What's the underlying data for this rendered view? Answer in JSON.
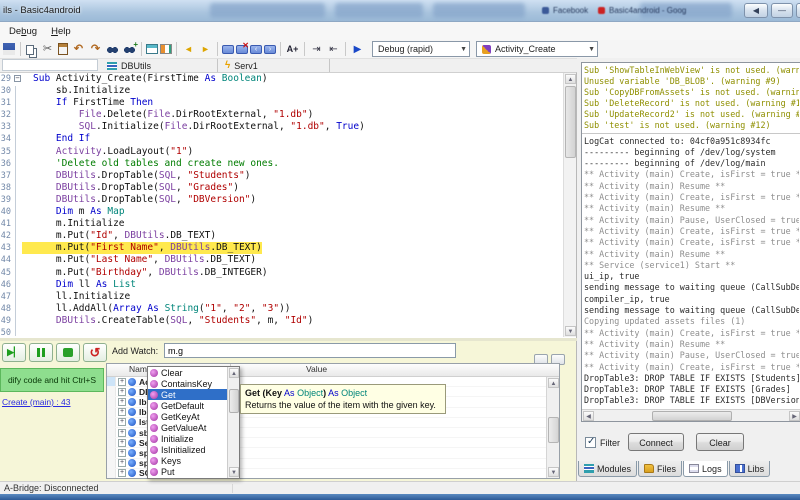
{
  "window": {
    "title": "ils - Basic4android"
  },
  "background": {
    "browser_tabs": [
      "Facebook",
      "Basic4android - Goog"
    ]
  },
  "menu": {
    "items": [
      {
        "label": "Debug",
        "underline": 2
      },
      {
        "label": "Help",
        "underline": 0
      }
    ]
  },
  "toolbar": {
    "icons": [
      "save",
      "sep",
      "copy",
      "cut",
      "paste",
      "undo",
      "redo",
      "find",
      "find-next",
      "sep",
      "designer",
      "bridge",
      "sep",
      "nav-back",
      "nav-forward",
      "sep",
      "comment-add",
      "comment-remove",
      "comment-prev",
      "comment-next",
      "sep",
      "font-size",
      "sep",
      "indent",
      "outdent",
      "sep",
      "run"
    ],
    "debug_mode": "Debug (rapid)",
    "current_sub": "Activity_Create"
  },
  "module_tabs": [
    "DBUtils",
    "Serv1"
  ],
  "editor": {
    "lines": [
      {
        "n": 29,
        "fold": 1,
        "t": [
          [
            "k",
            "Sub "
          ],
          [
            "p",
            "Activity_Create(FirstTime "
          ],
          [
            "k",
            "As "
          ],
          [
            "t",
            "Boolean"
          ],
          [
            "p",
            ")"
          ]
        ]
      },
      {
        "n": 30,
        "t": [
          [
            "p",
            "    sb.Initialize"
          ]
        ]
      },
      {
        "n": 31,
        "t": [
          [
            "p",
            "    "
          ],
          [
            "k",
            "If "
          ],
          [
            "p",
            "FirstTime "
          ],
          [
            "k",
            "Then"
          ]
        ]
      },
      {
        "n": 32,
        "t": [
          [
            "p",
            "        "
          ],
          [
            "m",
            "File"
          ],
          [
            "p",
            ".Delete("
          ],
          [
            "m",
            "File"
          ],
          [
            "p",
            ".DirRootExternal, "
          ],
          [
            "s",
            "\"1.db\""
          ],
          [
            "p",
            ")"
          ]
        ]
      },
      {
        "n": 33,
        "t": [
          [
            "p",
            "        "
          ],
          [
            "m",
            "SQL"
          ],
          [
            "p",
            ".Initialize("
          ],
          [
            "m",
            "File"
          ],
          [
            "p",
            ".DirRootExternal, "
          ],
          [
            "s",
            "\"1.db\""
          ],
          [
            "p",
            ", "
          ],
          [
            "k",
            "True"
          ],
          [
            "p",
            ")"
          ]
        ]
      },
      {
        "n": 34,
        "t": [
          [
            "p",
            "    "
          ],
          [
            "k",
            "End If"
          ]
        ]
      },
      {
        "n": 35,
        "t": [
          [
            "p",
            "    "
          ],
          [
            "m",
            "Activity"
          ],
          [
            "p",
            ".LoadLayout("
          ],
          [
            "s",
            "\"1\""
          ],
          [
            "p",
            ")"
          ]
        ]
      },
      {
        "n": 36,
        "t": [
          [
            "p",
            "    "
          ],
          [
            "c",
            "'Delete old tables and create new ones."
          ]
        ]
      },
      {
        "n": 37,
        "t": [
          [
            "p",
            "    "
          ],
          [
            "m",
            "DBUtils"
          ],
          [
            "p",
            ".DropTable("
          ],
          [
            "m",
            "SQL"
          ],
          [
            "p",
            ", "
          ],
          [
            "s",
            "\"Students\""
          ],
          [
            "p",
            ")"
          ]
        ]
      },
      {
        "n": 38,
        "t": [
          [
            "p",
            "    "
          ],
          [
            "m",
            "DBUtils"
          ],
          [
            "p",
            ".DropTable("
          ],
          [
            "m",
            "SQL"
          ],
          [
            "p",
            ", "
          ],
          [
            "s",
            "\"Grades\""
          ],
          [
            "p",
            ")"
          ]
        ]
      },
      {
        "n": 39,
        "t": [
          [
            "p",
            "    "
          ],
          [
            "m",
            "DBUtils"
          ],
          [
            "p",
            ".DropTable("
          ],
          [
            "m",
            "SQL"
          ],
          [
            "p",
            ", "
          ],
          [
            "s",
            "\"DBVersion\""
          ],
          [
            "p",
            ")"
          ]
        ]
      },
      {
        "n": 40,
        "t": [
          [
            "p",
            "    "
          ],
          [
            "k",
            "Dim "
          ],
          [
            "p",
            "m "
          ],
          [
            "k",
            "As "
          ],
          [
            "t",
            "Map"
          ]
        ]
      },
      {
        "n": 41,
        "t": [
          [
            "p",
            "    m.Initialize"
          ]
        ]
      },
      {
        "n": 42,
        "t": [
          [
            "p",
            "    m.Put("
          ],
          [
            "s",
            "\"Id\""
          ],
          [
            "p",
            ", "
          ],
          [
            "m",
            "DBUtils"
          ],
          [
            "p",
            ".DB_TEXT)"
          ]
        ]
      },
      {
        "n": 43,
        "hl": 1,
        "t": [
          [
            "p",
            "    m.Put("
          ],
          [
            "s",
            "\"First Name\""
          ],
          [
            "p",
            ", "
          ],
          [
            "m",
            "DBUtils"
          ],
          [
            "p",
            ".DB_TEXT)"
          ]
        ]
      },
      {
        "n": 44,
        "t": [
          [
            "p",
            "    m.Put("
          ],
          [
            "s",
            "\"Last Name\""
          ],
          [
            "p",
            ", "
          ],
          [
            "m",
            "DBUtils"
          ],
          [
            "p",
            ".DB_TEXT)"
          ]
        ]
      },
      {
        "n": 45,
        "t": [
          [
            "p",
            "    m.Put("
          ],
          [
            "s",
            "\"Birthday\""
          ],
          [
            "p",
            ", "
          ],
          [
            "m",
            "DBUtils"
          ],
          [
            "p",
            ".DB_INTEGER)"
          ]
        ]
      },
      {
        "n": 46,
        "t": [
          [
            "p",
            "    "
          ],
          [
            "k",
            "Dim "
          ],
          [
            "p",
            "ll "
          ],
          [
            "k",
            "As "
          ],
          [
            "t",
            "List"
          ]
        ]
      },
      {
        "n": 47,
        "t": [
          [
            "p",
            "    ll.Initialize"
          ]
        ]
      },
      {
        "n": 48,
        "t": [
          [
            "p",
            "    ll.AddAll("
          ],
          [
            "k",
            "Array "
          ],
          [
            "k",
            "As "
          ],
          [
            "t",
            "String"
          ],
          [
            "p",
            "("
          ],
          [
            "s",
            "\"1\""
          ],
          [
            "p",
            ", "
          ],
          [
            "s",
            "\"2\""
          ],
          [
            "p",
            ", "
          ],
          [
            "s",
            "\"3\""
          ],
          [
            "p",
            "))"
          ]
        ]
      },
      {
        "n": 49,
        "t": [
          [
            "p",
            "    "
          ],
          [
            "m",
            "DBUtils"
          ],
          [
            "p",
            ".CreateTable("
          ],
          [
            "m",
            "SQL"
          ],
          [
            "p",
            ", "
          ],
          [
            "s",
            "\"Students\""
          ],
          [
            "p",
            ", m, "
          ],
          [
            "s",
            "\"Id\""
          ],
          [
            "p",
            ")"
          ]
        ]
      },
      {
        "n": 50,
        "t": []
      }
    ]
  },
  "debug_panel": {
    "add_watch_label": "Add Watch:",
    "add_watch_value": "m.g",
    "status_message": "dify code and hit Ctrl+S",
    "location_link": "Create (main) : 43",
    "watch_columns": [
      "Name",
      "Value"
    ],
    "watch_rows": [
      "Act",
      "DB",
      "lblB",
      "lblS",
      "lstF",
      "sb",
      "Ser",
      "spr",
      "spr",
      "SQ"
    ]
  },
  "autocomplete": {
    "items": [
      "Clear",
      "ContainsKey",
      "Get",
      "GetDefault",
      "GetKeyAt",
      "GetValueAt",
      "Initialize",
      "IsInitialized",
      "Keys",
      "Put"
    ],
    "selected": "Get"
  },
  "tooltip": {
    "signature": [
      [
        "b",
        "Get ("
      ],
      [
        "b",
        "Key"
      ],
      [
        "p",
        " "
      ],
      [
        "k",
        "As"
      ],
      [
        "p",
        " "
      ],
      [
        "t",
        "Object"
      ],
      [
        "b",
        ")"
      ],
      [
        "p",
        " "
      ],
      [
        "k",
        "As"
      ],
      [
        "p",
        " "
      ],
      [
        "t",
        "Object"
      ]
    ],
    "description": "Returns the value of the item with the given key."
  },
  "logs_panel": {
    "warnings": [
      "Sub 'ShowTableInWebView' is not used. (warning #12)",
      "Unused variable 'DB_BLOB'. (warning #9)",
      "Sub 'CopyDBFromAssets' is not used. (warning #12)",
      "Sub 'DeleteRecord' is not used. (warning #12)",
      "Sub 'UpdateRecord2' is not used. (warning #12)",
      "Sub 'test' is not used. (warning #12)"
    ],
    "lines": [
      [
        "LogCat connected to: 04cf0a951c8934fc",
        0
      ],
      [
        "--------- beginning of /dev/log/system",
        0
      ],
      [
        "--------- beginning of /dev/log/main",
        0
      ],
      [
        "** Activity (main) Create, isFirst = true **",
        1
      ],
      [
        "** Activity (main) Resume **",
        1
      ],
      [
        "** Activity (main) Create, isFirst = true **",
        1
      ],
      [
        "** Activity (main) Resume **",
        1
      ],
      [
        "** Activity (main) Pause, UserClosed = true **",
        1
      ],
      [
        "** Activity (main) Create, isFirst = true **",
        1
      ],
      [
        "** Activity (main) Create, isFirst = true **",
        1
      ],
      [
        "** Activity (main) Resume **",
        1
      ],
      [
        "** Service (service1) Start **",
        1
      ],
      [
        "ui_ip, true",
        0
      ],
      [
        "sending message to waiting queue (CallSubDe",
        0
      ],
      [
        "compiler_ip, true",
        0
      ],
      [
        "sending message to waiting queue (CallSubDe",
        0
      ],
      [
        "Copying updated assets files (1)",
        1
      ],
      [
        "** Activity (main) Create, isFirst = true **",
        1
      ],
      [
        "** Activity (main) Resume **",
        1
      ],
      [
        "** Activity (main) Pause, UserClosed = true **",
        1
      ],
      [
        "** Activity (main) Create, isFirst = true **",
        1
      ],
      [
        "DropTable3: DROP TABLE IF EXISTS [Students]",
        0
      ],
      [
        "DropTable3: DROP TABLE IF EXISTS [Grades]",
        0
      ],
      [
        "DropTable3: DROP TABLE IF EXISTS [DBVersion]",
        0
      ]
    ],
    "filter_label": "Filter",
    "connect_label": "Connect",
    "clear_label": "Clear",
    "tabs": [
      "Modules",
      "Files",
      "Logs",
      "Libs"
    ],
    "active_tab": "Logs"
  },
  "status_bar": {
    "text": "A-Bridge: Disconnected"
  },
  "colors": {
    "keyword": "#0000cc",
    "type": "#00857a",
    "string": "#b00000",
    "comment": "#007c00",
    "module": "#7b3fa0",
    "warning": "#8f8f00",
    "muted_log": "#8e8e8e",
    "highlight": "#ffe94e",
    "selection": "#2f6fc8"
  }
}
